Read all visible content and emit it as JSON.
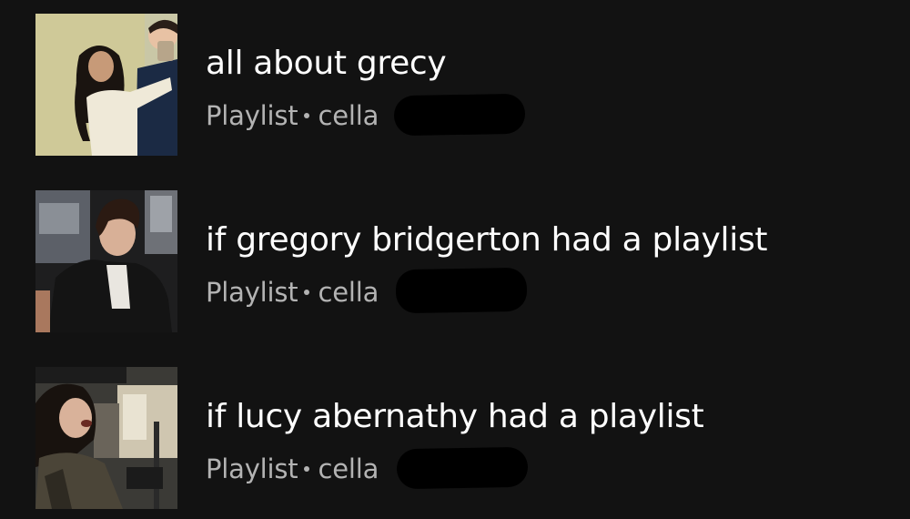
{
  "playlists": [
    {
      "title": "all about grecy",
      "type_label": "Playlist",
      "owner_prefix": "cella",
      "cover_icon": "cover-art-couple-photo"
    },
    {
      "title": "if gregory bridgerton had a playlist",
      "type_label": "Playlist",
      "owner_prefix": "cella",
      "cover_icon": "cover-art-man-in-car-photo"
    },
    {
      "title": "if lucy abernathy had a playlist",
      "type_label": "Playlist",
      "owner_prefix": "cella",
      "cover_icon": "cover-art-woman-laughing-photo"
    }
  ],
  "colors": {
    "background": "#121212",
    "title": "#ffffff",
    "subtitle": "#b3b3b3",
    "redaction": "#000000"
  }
}
